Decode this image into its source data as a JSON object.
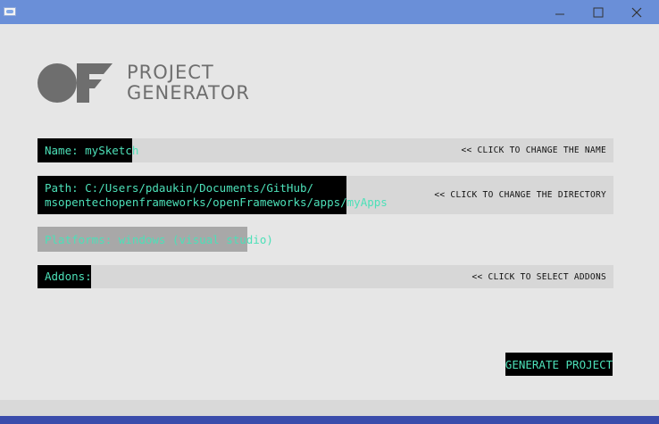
{
  "window": {
    "controls": {
      "minimize_icon": "minimize-icon",
      "maximize_icon": "maximize-icon",
      "close_icon": "close-icon"
    }
  },
  "branding": {
    "logo_icon": "of-logo",
    "line1": "PROJECT",
    "line2": "GENERATOR"
  },
  "fields": {
    "name": {
      "label": "Name: mySketch",
      "hint": "<< CLICK TO CHANGE THE NAME"
    },
    "path": {
      "line1": "Path: C:/Users/pdaukin/Documents/GitHub/",
      "line2": "msopentechopenframeworks/openFrameworks/apps/myApps",
      "hint": "<< CLICK TO CHANGE THE DIRECTORY"
    },
    "platforms": {
      "label": "Platforms: windows (visual studio)"
    },
    "addons": {
      "label": "Addons:",
      "hint": "<< CLICK TO SELECT ADDONS"
    }
  },
  "actions": {
    "generate_label": "GENERATE PROJECT"
  },
  "colors": {
    "accent_text": "#4ce0b8",
    "label_background": "#000000",
    "row_background": "#d7d7d7",
    "titlebar": "#6a8fd8",
    "window_background": "#e6e6e6"
  }
}
